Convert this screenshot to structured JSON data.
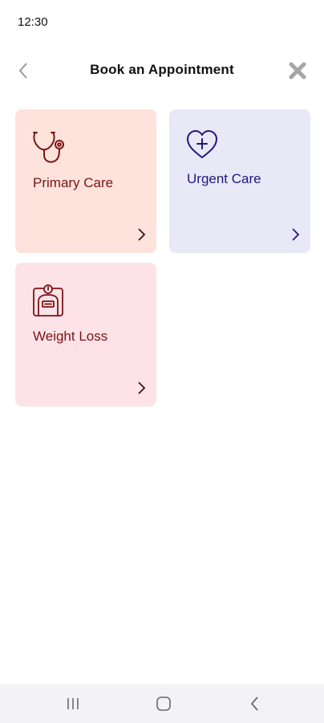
{
  "status_bar": {
    "time": "12:30"
  },
  "header": {
    "title": "Book an Appointment"
  },
  "cards": [
    {
      "label": "Primary Care",
      "icon": "stethoscope-icon",
      "bg": "#fde3dc",
      "text_color": "#7a1414"
    },
    {
      "label": "Urgent Care",
      "icon": "heart-plus-icon",
      "bg": "#e9e8f7",
      "text_color": "#1d1a7e"
    },
    {
      "label": "Weight Loss",
      "icon": "scale-icon",
      "bg": "#fde3e7",
      "text_color": "#7a1414"
    }
  ],
  "nav_bar": {
    "buttons": [
      "recents-icon",
      "home-icon",
      "back-icon"
    ]
  }
}
